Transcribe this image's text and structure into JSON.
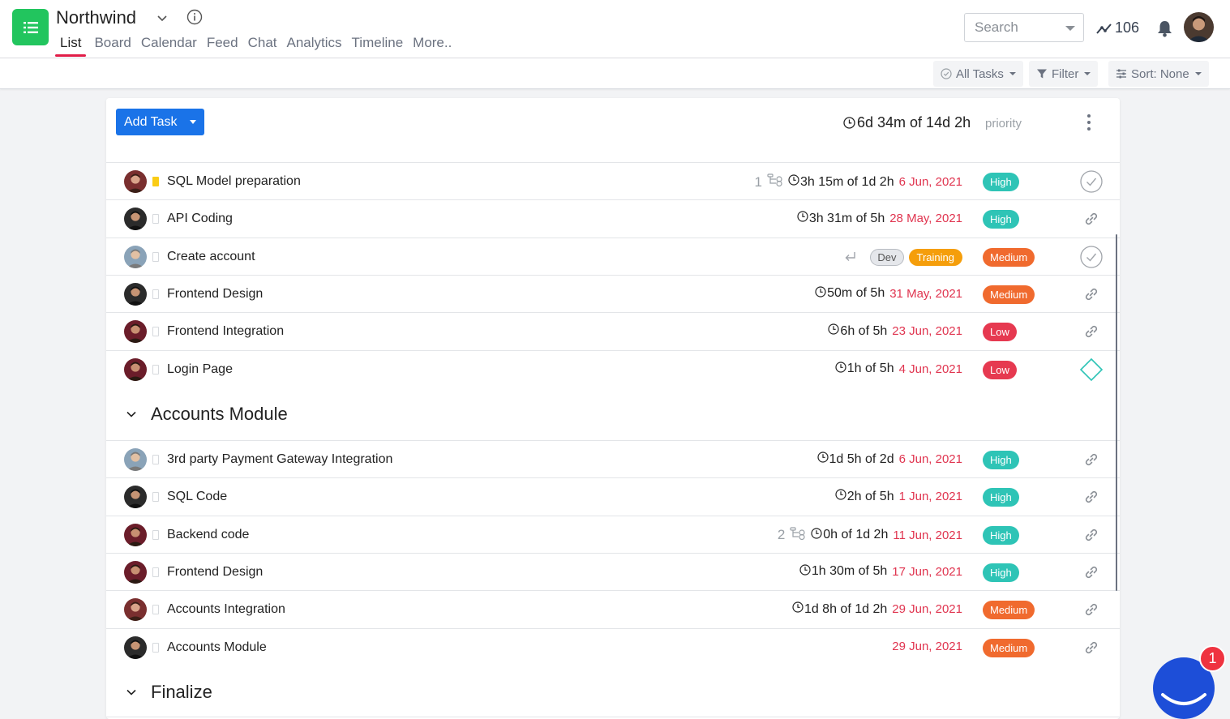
{
  "header": {
    "project_title": "Northwind",
    "tabs": [
      "List",
      "Board",
      "Calendar",
      "Feed",
      "Chat",
      "Analytics",
      "Timeline",
      "More.."
    ],
    "active_tab": "List",
    "search_placeholder": "Search",
    "activity_count": "106",
    "icons": [
      "list-icon",
      "chevron-down-icon",
      "info-icon",
      "trend-icon",
      "bell-icon"
    ]
  },
  "toolbar": {
    "all_tasks_label": "All Tasks",
    "filter_label": "Filter",
    "sort_label": "Sort: None"
  },
  "panel": {
    "add_task_label": "Add Task",
    "total_time": "6d 34m of 14d 2h",
    "priority_column": "priority"
  },
  "rows_group1": [
    {
      "name": "SQL Model preparation",
      "subtasks": "1",
      "time": "3h 15m of 1d 2h",
      "due": "6 Jun, 2021",
      "priority": "High",
      "action": "check",
      "flag": "yellow"
    },
    {
      "name": "API Coding",
      "time": "3h 31m of 5h",
      "due": "28 May, 2021",
      "priority": "High",
      "action": "link"
    },
    {
      "name": "Create account",
      "tags": [
        "Dev",
        "Training"
      ],
      "priority": "Medium",
      "action": "check"
    },
    {
      "name": "Frontend Design",
      "time": "50m of 5h",
      "due": "31 May, 2021",
      "priority": "Medium",
      "action": "link"
    },
    {
      "name": "Frontend Integration",
      "time": "6h of 5h",
      "due": "23 Jun, 2021",
      "priority": "Low",
      "action": "link"
    },
    {
      "name": "Login Page",
      "time": "1h of 5h",
      "due": "4 Jun, 2021",
      "priority": "Low",
      "action": "diamond"
    }
  ],
  "group2": {
    "title": "Accounts Module",
    "rows": [
      {
        "name": "3rd party Payment Gateway Integration",
        "time": "1d 5h of 2d",
        "due": "6 Jun, 2021",
        "priority": "High",
        "action": "link"
      },
      {
        "name": "SQL Code",
        "time": "2h of 5h",
        "due": "1 Jun, 2021",
        "priority": "High",
        "action": "link"
      },
      {
        "name": "Backend code",
        "subtasks": "2",
        "time": "0h of 1d 2h",
        "due": "11 Jun, 2021",
        "priority": "High",
        "action": "link"
      },
      {
        "name": "Frontend Design",
        "time": "1h 30m of 5h",
        "due": "17 Jun, 2021",
        "priority": "High",
        "action": "link"
      },
      {
        "name": "Accounts Integration",
        "time": "1d 8h of 1d 2h",
        "due": "29 Jun, 2021",
        "priority": "Medium",
        "action": "link"
      },
      {
        "name": "Accounts Module",
        "due": "29 Jun, 2021",
        "priority": "Medium",
        "action": "link"
      }
    ]
  },
  "group3": {
    "title": "Finalize"
  },
  "chat_widget": {
    "badge": "1"
  },
  "colors": {
    "accent": "#1a73e8",
    "logo": "#22c55e",
    "high": "#2ec4b6",
    "medium": "#f06a2e",
    "low": "#e63950",
    "due": "#e0344f"
  }
}
